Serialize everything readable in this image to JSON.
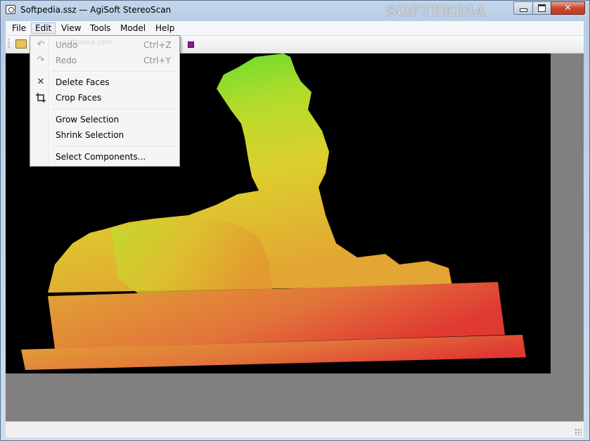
{
  "window": {
    "title": "Softpedia.ssz — AgiSoft StereoScan",
    "watermark": "SOFTPEDIA"
  },
  "menubar": {
    "items": [
      {
        "label": "File"
      },
      {
        "label": "Edit"
      },
      {
        "label": "View"
      },
      {
        "label": "Tools"
      },
      {
        "label": "Model"
      },
      {
        "label": "Help"
      }
    ]
  },
  "edit_menu": {
    "items": [
      {
        "label": "Undo",
        "shortcut": "Ctrl+Z",
        "icon": "undo-icon",
        "enabled": false
      },
      {
        "label": "Redo",
        "shortcut": "Ctrl+Y",
        "icon": "redo-icon",
        "enabled": false
      },
      {
        "label": "Delete Faces",
        "shortcut": "",
        "icon": "delete-x-icon",
        "enabled": true
      },
      {
        "label": "Crop Faces",
        "shortcut": "",
        "icon": "crop-icon",
        "enabled": true
      },
      {
        "label": "Grow Selection",
        "shortcut": "",
        "icon": "",
        "enabled": true
      },
      {
        "label": "Shrink Selection",
        "shortcut": "",
        "icon": "",
        "enabled": true
      },
      {
        "label": "Select Components...",
        "shortcut": "",
        "icon": "",
        "enabled": true
      }
    ]
  },
  "viewport": {
    "description_colors": {
      "top": "#4cdc2c",
      "middle": "#d8d22c",
      "bottom": "#e03a32",
      "background": "#000000"
    }
  },
  "colors": {
    "menu_highlight": "#e8eef7",
    "close_button": "#c9462c"
  }
}
